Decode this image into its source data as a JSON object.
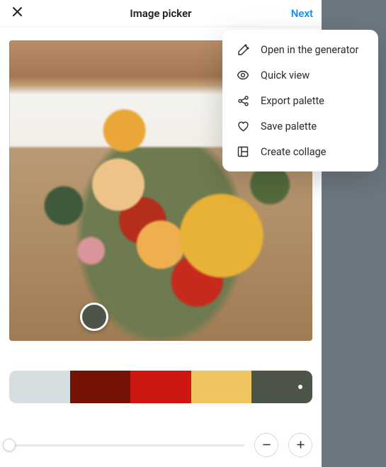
{
  "header": {
    "title": "Image picker",
    "next_label": "Next"
  },
  "palette": {
    "colors": [
      "#d6dee2",
      "#741205",
      "#cf1712",
      "#efc560",
      "#4c5548"
    ],
    "active_index": 4
  },
  "picker": {
    "current_color": "#4c5548"
  },
  "slider": {
    "position": 0
  },
  "menu": {
    "items": [
      {
        "icon": "wand-icon",
        "label": "Open in the generator"
      },
      {
        "icon": "eye-icon",
        "label": "Quick view"
      },
      {
        "icon": "share-icon",
        "label": "Export palette"
      },
      {
        "icon": "heart-icon",
        "label": "Save palette"
      },
      {
        "icon": "collage-icon",
        "label": "Create collage"
      }
    ]
  }
}
